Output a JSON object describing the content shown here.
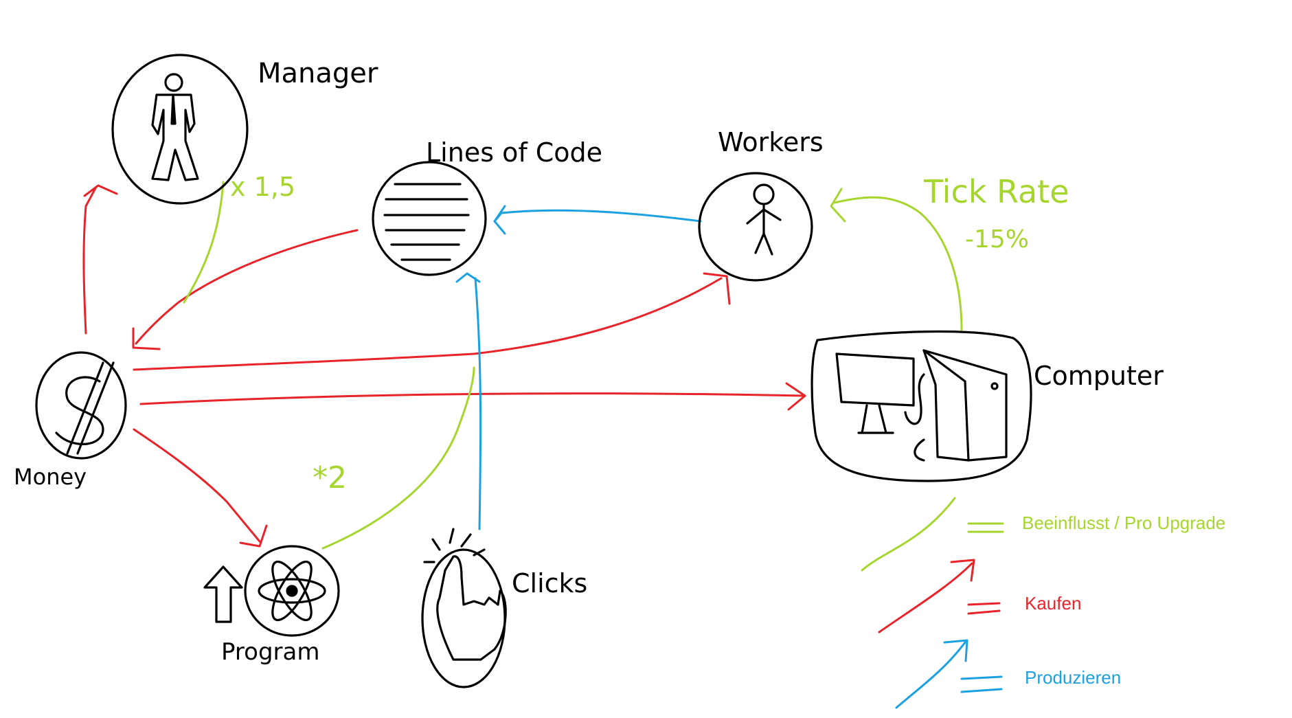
{
  "nodes": {
    "manager": "Manager",
    "lines_of_code": "Lines of Code",
    "workers": "Workers",
    "computer": "Computer",
    "money": "Money",
    "program": "Program",
    "clicks": "Clicks"
  },
  "annotations": {
    "manager_factor": "x 1,5",
    "program_factor": "*2",
    "tick_rate": "Tick Rate",
    "tick_rate_change": "-15%"
  },
  "legend": {
    "influences": "Beeinflusst / Pro Upgrade",
    "buy": "Kaufen",
    "produce": "Produzieren"
  },
  "colors": {
    "influences": "#a6d52e",
    "buy": "#e8232a",
    "produce": "#1ba1e2",
    "ink": "#000000"
  }
}
